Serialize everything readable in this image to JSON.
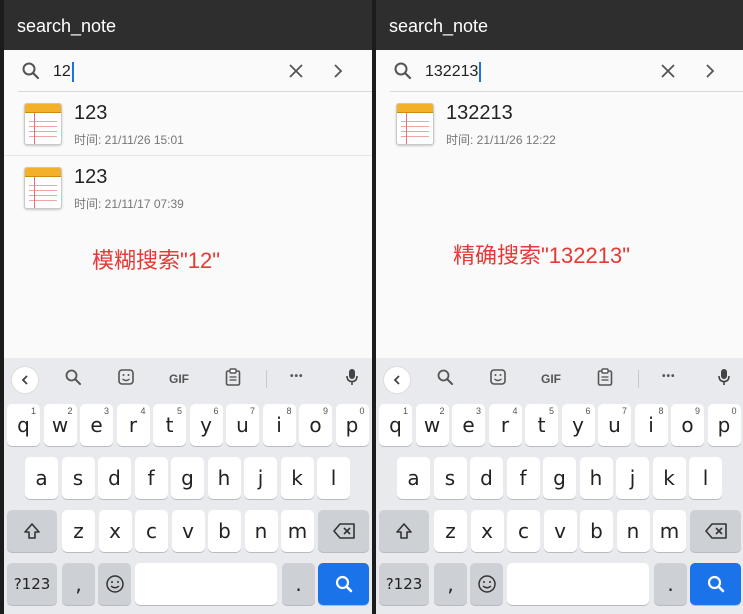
{
  "app_title": "search_note",
  "colors": {
    "appbar": "#2e2e2e",
    "accent": "#1a73e8",
    "annotation": "#e53935",
    "note_icon": "#f2b128"
  },
  "keyboard": {
    "toolbar_icons": [
      "back-icon",
      "search-icon",
      "sticker-icon",
      "gif-icon",
      "clipboard-icon",
      "more-icon",
      "microphone-icon"
    ],
    "gif_label": "GIF",
    "more_label": "•••",
    "row1": [
      "q",
      "w",
      "e",
      "r",
      "t",
      "y",
      "u",
      "i",
      "o",
      "p"
    ],
    "row1_hints": [
      "1",
      "2",
      "3",
      "4",
      "5",
      "6",
      "7",
      "8",
      "9",
      "0"
    ],
    "row2": [
      "a",
      "s",
      "d",
      "f",
      "g",
      "h",
      "j",
      "k",
      "l"
    ],
    "row3": [
      "z",
      "x",
      "c",
      "v",
      "b",
      "n",
      "m"
    ],
    "symbols_label": "?123",
    "comma_label": ",",
    "period_label": "."
  },
  "panels": [
    {
      "query": "12",
      "results": [
        {
          "title": "123",
          "time": "时间: 21/11/26 15:01"
        },
        {
          "title": "123",
          "time": "时间: 21/11/17 07:39"
        }
      ],
      "annotation": "模糊搜索\"12\""
    },
    {
      "query": "132213",
      "results": [
        {
          "title": "132213",
          "time": "时间: 21/11/26 12:22"
        }
      ],
      "annotation": "精确搜索\"132213\""
    }
  ]
}
